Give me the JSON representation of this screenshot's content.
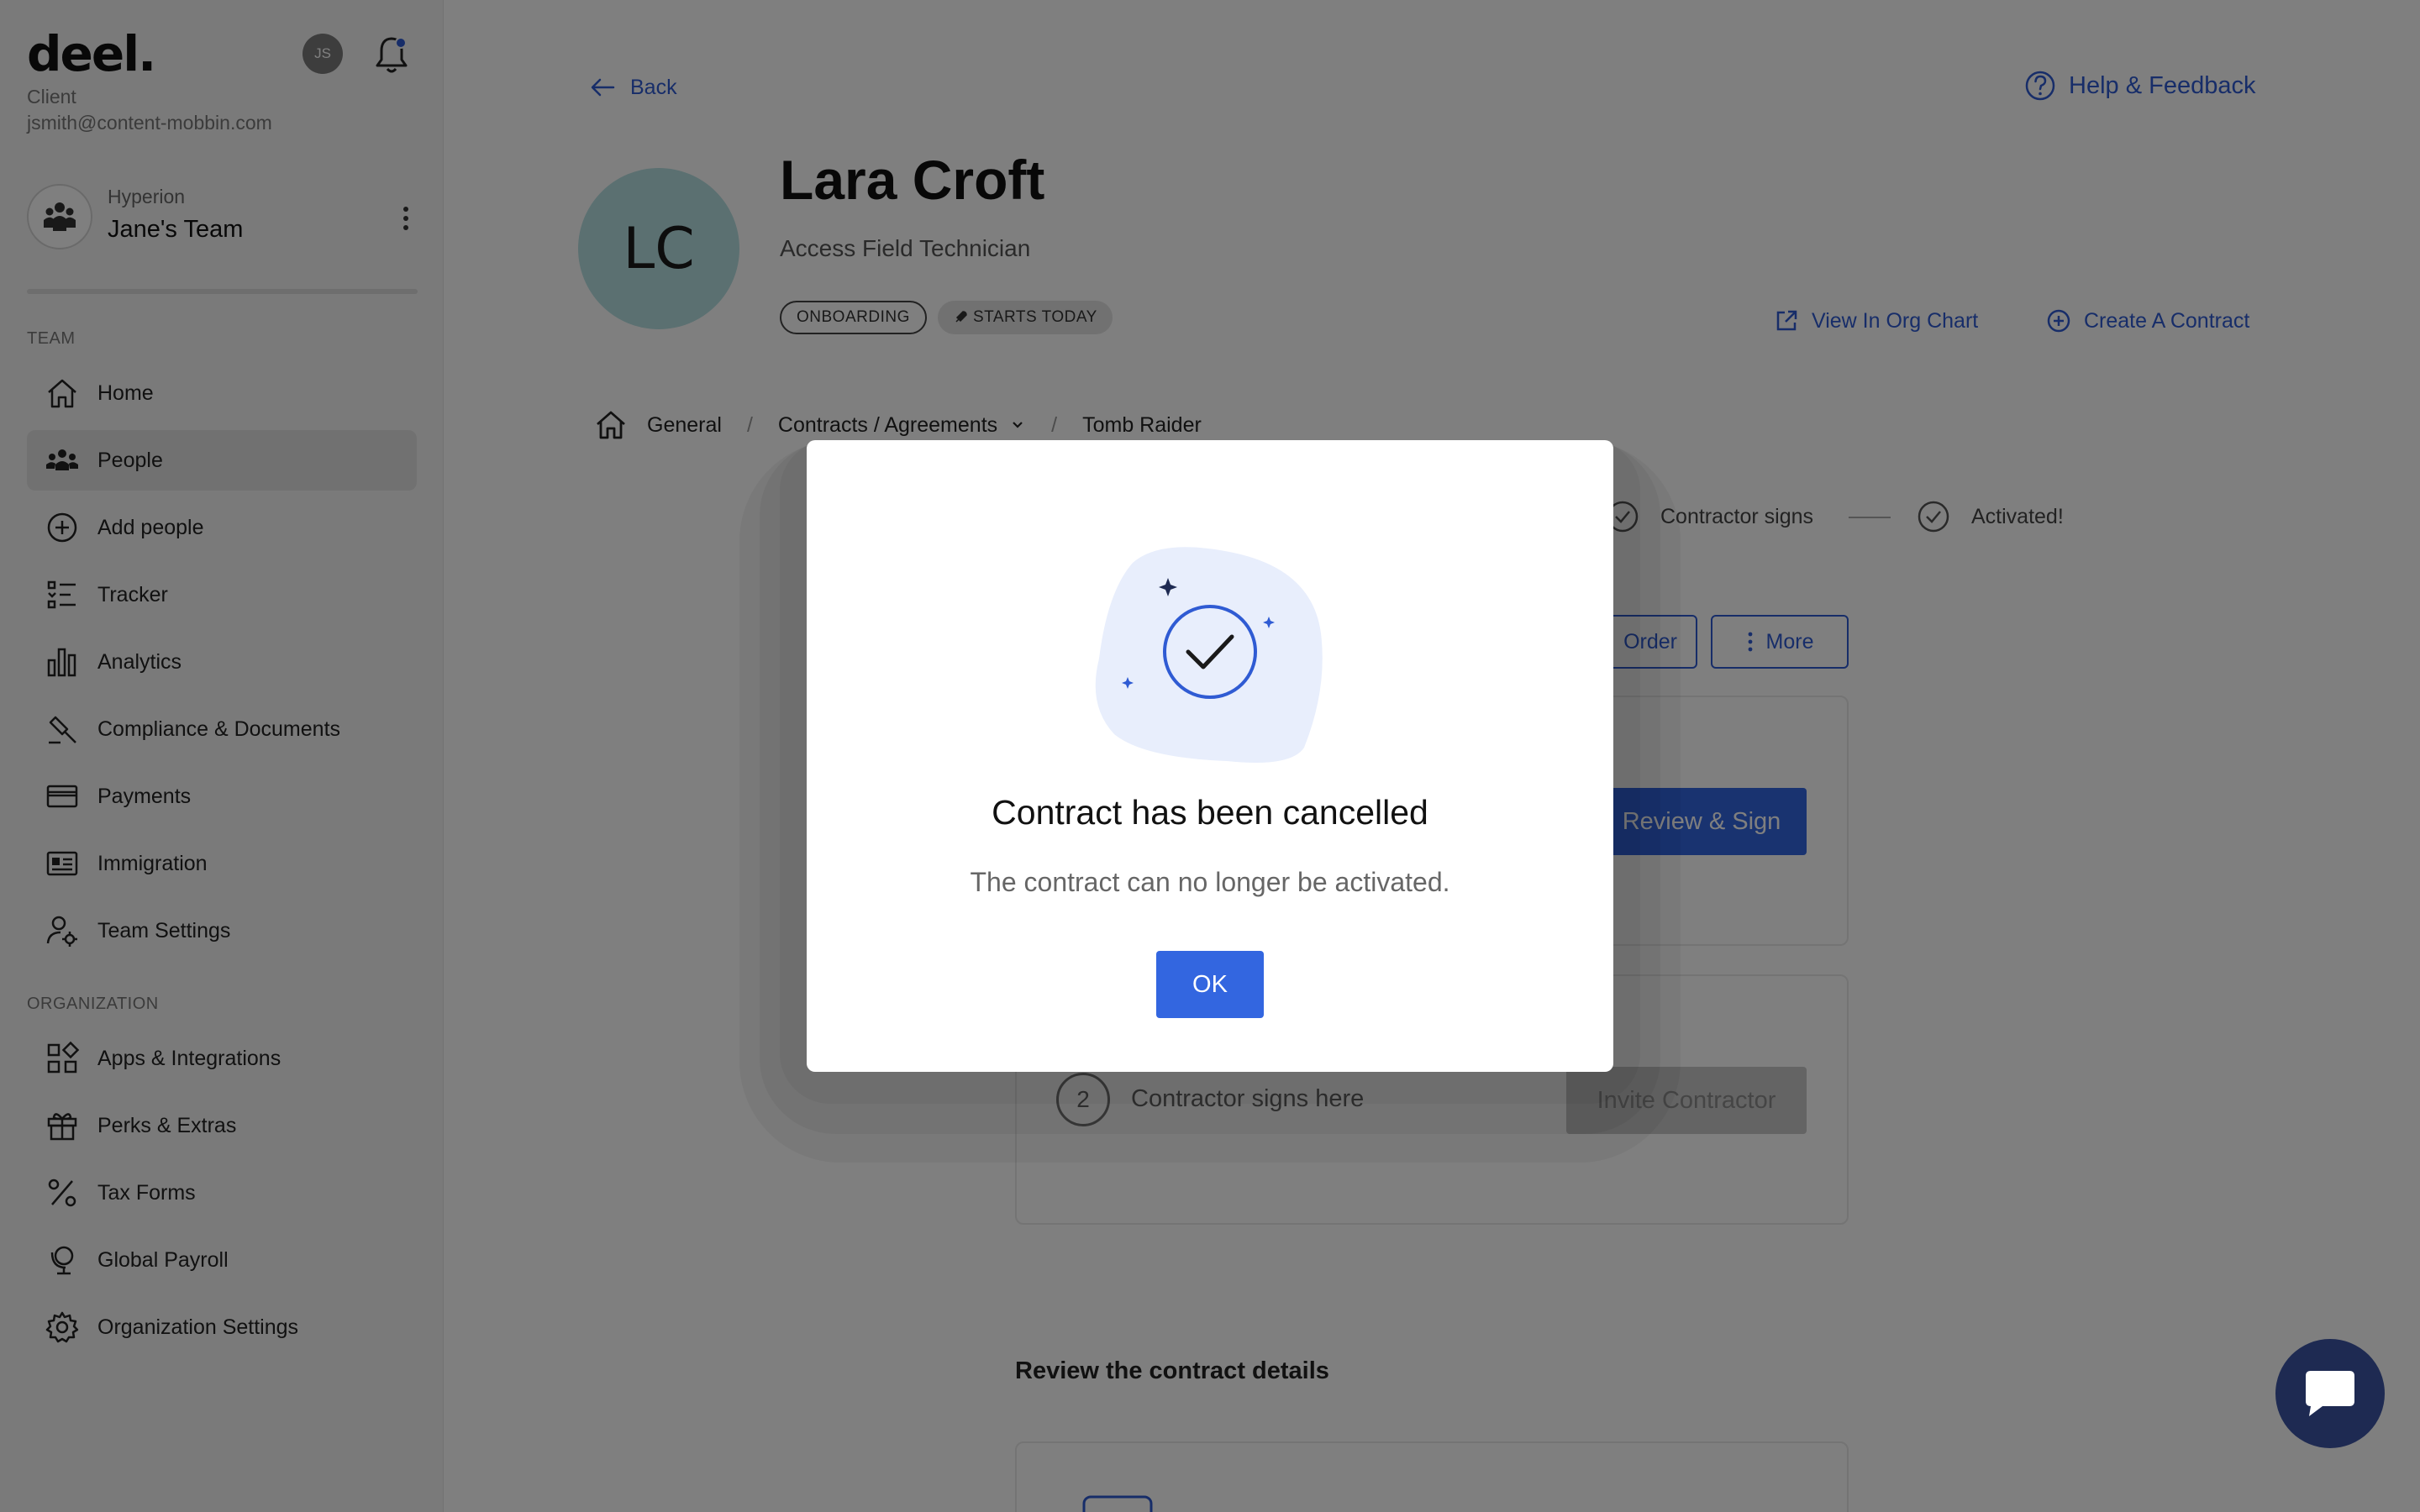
{
  "sidebar": {
    "logo": "deel.",
    "account_type": "Client",
    "email": "jsmith@content-mobbin.com",
    "user_initials": "JS",
    "org": {
      "company": "Hyperion",
      "team": "Jane's Team"
    },
    "team_label": "TEAM",
    "team_items": [
      {
        "label": "Home",
        "icon": "home-icon"
      },
      {
        "label": "People",
        "icon": "people-icon",
        "active": true
      },
      {
        "label": "Add people",
        "icon": "plus-circle-icon"
      },
      {
        "label": "Tracker",
        "icon": "tracker-icon"
      },
      {
        "label": "Analytics",
        "icon": "bar-chart-icon"
      },
      {
        "label": "Compliance & Documents",
        "icon": "gavel-icon"
      },
      {
        "label": "Payments",
        "icon": "card-icon"
      },
      {
        "label": "Immigration",
        "icon": "id-card-icon"
      },
      {
        "label": "Team Settings",
        "icon": "user-gear-icon"
      }
    ],
    "org_label": "ORGANIZATION",
    "org_items": [
      {
        "label": "Apps & Integrations",
        "icon": "apps-icon"
      },
      {
        "label": "Perks & Extras",
        "icon": "gift-icon"
      },
      {
        "label": "Tax Forms",
        "icon": "percent-icon"
      },
      {
        "label": "Global Payroll",
        "icon": "globe-stand-icon"
      },
      {
        "label": "Organization Settings",
        "icon": "gear-icon"
      }
    ]
  },
  "header": {
    "back_label": "Back",
    "help_label": "Help & Feedback"
  },
  "profile": {
    "initials": "LC",
    "name": "Lara Croft",
    "role": "Access Field Technician",
    "badge_status": "ONBOARDING",
    "badge_start": "STARTS TODAY",
    "view_org_chart": "View In Org Chart",
    "create_contract": "Create A Contract"
  },
  "breadcrumb": {
    "home": "General",
    "contracts": "Contracts / Agreements",
    "current": "Tomb Raider"
  },
  "steps": {
    "contractor_signs": "Contractor signs",
    "activated": "Activated!"
  },
  "actions": {
    "order_label": "Order",
    "more_label": "More",
    "review_sign": "Review & Sign",
    "step2_number": "2",
    "step2_text": "Contractor signs here",
    "invite_contractor": "Invite Contractor",
    "review_details_title": "Review the contract details"
  },
  "modal": {
    "title": "Contract has been cancelled",
    "message": "The contract can no longer be activated.",
    "ok_label": "OK",
    "illustration_blob_color": "#e8eefc",
    "illustration_stroke_color": "#2f5bd3"
  },
  "colors": {
    "accent": "#2f5bd3",
    "primary_button": "#3366e0",
    "avatar_bg": "#b7e1e3",
    "chat_button": "#1e2a52"
  }
}
